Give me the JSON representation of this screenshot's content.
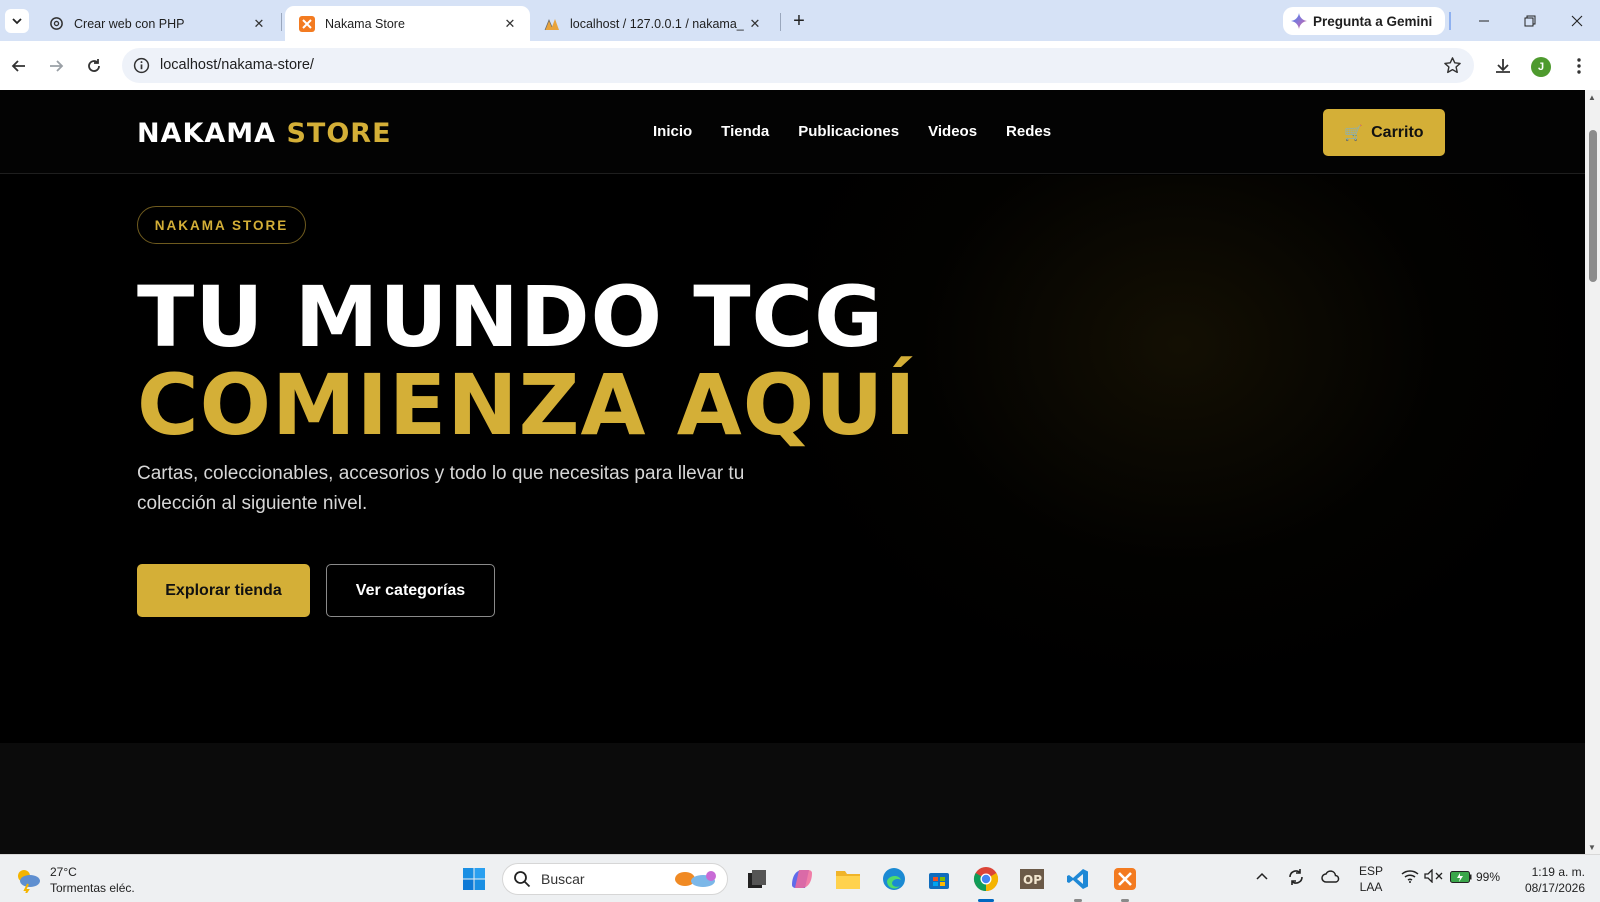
{
  "browser": {
    "tabs": [
      {
        "title": "Crear web con PHP",
        "icon": "chatgpt-icon",
        "active": false
      },
      {
        "title": "Nakama Store",
        "icon": "xampp-icon",
        "active": true
      },
      {
        "title": "localhost / 127.0.0.1 / nakama_",
        "icon": "phpmyadmin-icon",
        "active": false
      }
    ],
    "gemini_label": "Pregunta a Gemini",
    "url": "localhost/nakama-store/",
    "profile_initial": "J"
  },
  "site": {
    "logo_white": "NAKAMA",
    "logo_gold": "STORE",
    "nav": [
      "Inicio",
      "Tienda",
      "Publicaciones",
      "Videos",
      "Redes"
    ],
    "cart_label": "Carrito",
    "cart_icon": "🛒",
    "accent_color": "#d4af37"
  },
  "hero": {
    "badge": "NAKAMA STORE",
    "title_line1": "TU MUNDO TCG",
    "title_line2": "COMIENZA AQUÍ",
    "lead": "Cartas, coleccionables, accesorios y todo lo que necesitas para llevar tu colección al siguiente nivel.",
    "primary_button": "Explorar tienda",
    "secondary_button": "Ver categorías"
  },
  "taskbar": {
    "weather_temp": "27°C",
    "weather_desc": "Tormentas eléc.",
    "search_placeholder": "Buscar",
    "lang_line1": "ESP",
    "lang_line2": "LAA",
    "battery": "99%",
    "time": "1:19 a. m.",
    "date": "08/17/2026"
  }
}
